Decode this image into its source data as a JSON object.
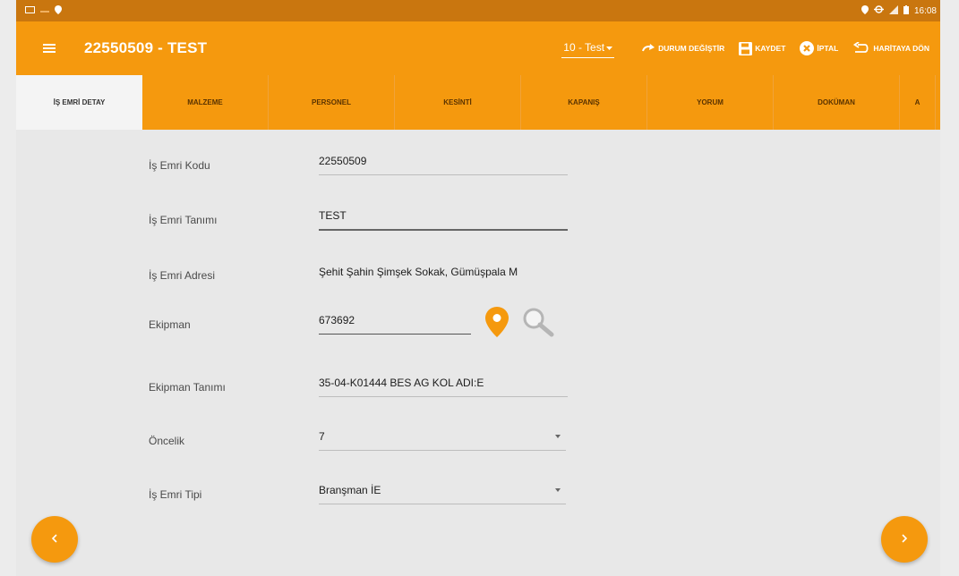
{
  "status_bar": {
    "time": "16:08",
    "left_icons": [
      "image-icon",
      "minus-icon",
      "location-pin-icon"
    ],
    "right_icons": [
      "location-pin-icon",
      "sync-icon",
      "signal-icon",
      "battery-icon"
    ]
  },
  "header": {
    "title": "22550509 - TEST",
    "status_select": "10 - Test",
    "actions": {
      "change_status": "DURUM DEĞİŞTİR",
      "save": "KAYDET",
      "cancel": "İPTAL",
      "back_to_map": "HARİTAYA DÖN"
    }
  },
  "tabs": [
    {
      "label": "İŞ EMRİ DETAY",
      "active": true
    },
    {
      "label": "MALZEME",
      "active": false
    },
    {
      "label": "PERSONEL",
      "active": false
    },
    {
      "label": "KESİNTİ",
      "active": false
    },
    {
      "label": "KAPANIŞ",
      "active": false
    },
    {
      "label": "YORUM",
      "active": false
    },
    {
      "label": "DOKÜMAN",
      "active": false
    },
    {
      "label": "A",
      "active": false
    }
  ],
  "form": {
    "work_order_code": {
      "label": "İş Emri Kodu",
      "value": "22550509"
    },
    "work_order_desc": {
      "label": "İş Emri Tanımı",
      "value": "TEST"
    },
    "work_order_address": {
      "label": "İş Emri Adresi",
      "value": "Şehit Şahin Şimşek Sokak, Gümüşpala M"
    },
    "equipment": {
      "label": "Ekipman",
      "value": "673692"
    },
    "equipment_desc": {
      "label": "Ekipman Tanımı",
      "value": "35-04-K01444 BES AG KOL ADI:E"
    },
    "priority": {
      "label": "Öncelik",
      "value": "7"
    },
    "work_order_type": {
      "label": "İş Emri Tipi",
      "value": "Branşman İE"
    }
  },
  "colors": {
    "primary": "#f5990e",
    "status_bar": "#c9760f",
    "background": "#e8e8e8"
  }
}
